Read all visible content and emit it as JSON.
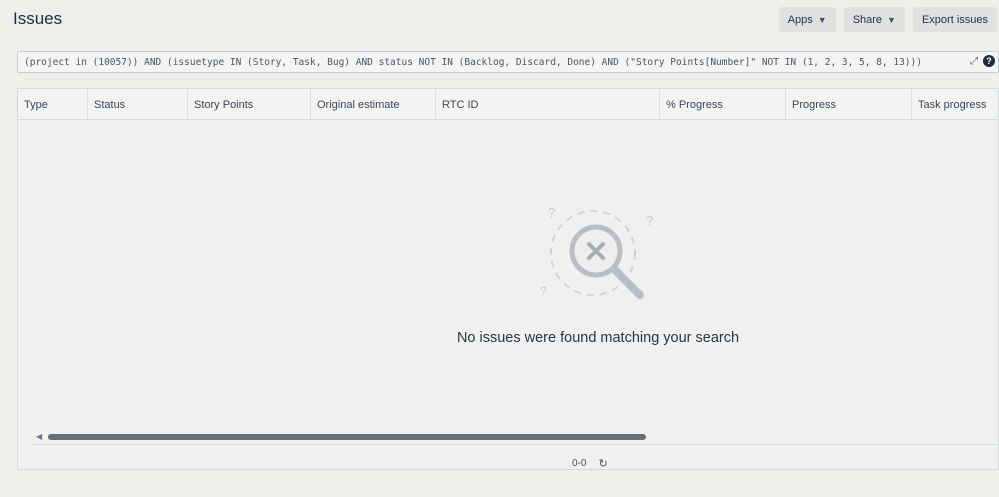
{
  "header": {
    "title": "Issues",
    "actions": [
      {
        "label": "Apps",
        "has_dropdown": true
      },
      {
        "label": "Share",
        "has_dropdown": true
      },
      {
        "label": "Export issues",
        "has_dropdown": false
      }
    ]
  },
  "query": {
    "text": "(project in (10057)) AND (issuetype IN (Story, Task, Bug) AND status NOT IN (Backlog, Discard, Done) AND (\"Story Points[Number]\" NOT IN (1, 2, 3, 5, 8, 13)))",
    "expand_icon": "expand-icon",
    "help_icon": "help-icon"
  },
  "table": {
    "columns": [
      "Type",
      "Status",
      "Story Points",
      "Original estimate",
      "RTC ID",
      "% Progress",
      "Progress",
      "Task progress"
    ],
    "rows": [],
    "empty_message": "No issues were found matching your search"
  },
  "pagination": {
    "range": "0-0",
    "refresh_icon": "refresh-icon"
  },
  "colors": {
    "background": "#eeeeeb",
    "text": "#172b4d",
    "scroll_thumb": "#6b6e72",
    "illustration": "#c8ccd2"
  }
}
